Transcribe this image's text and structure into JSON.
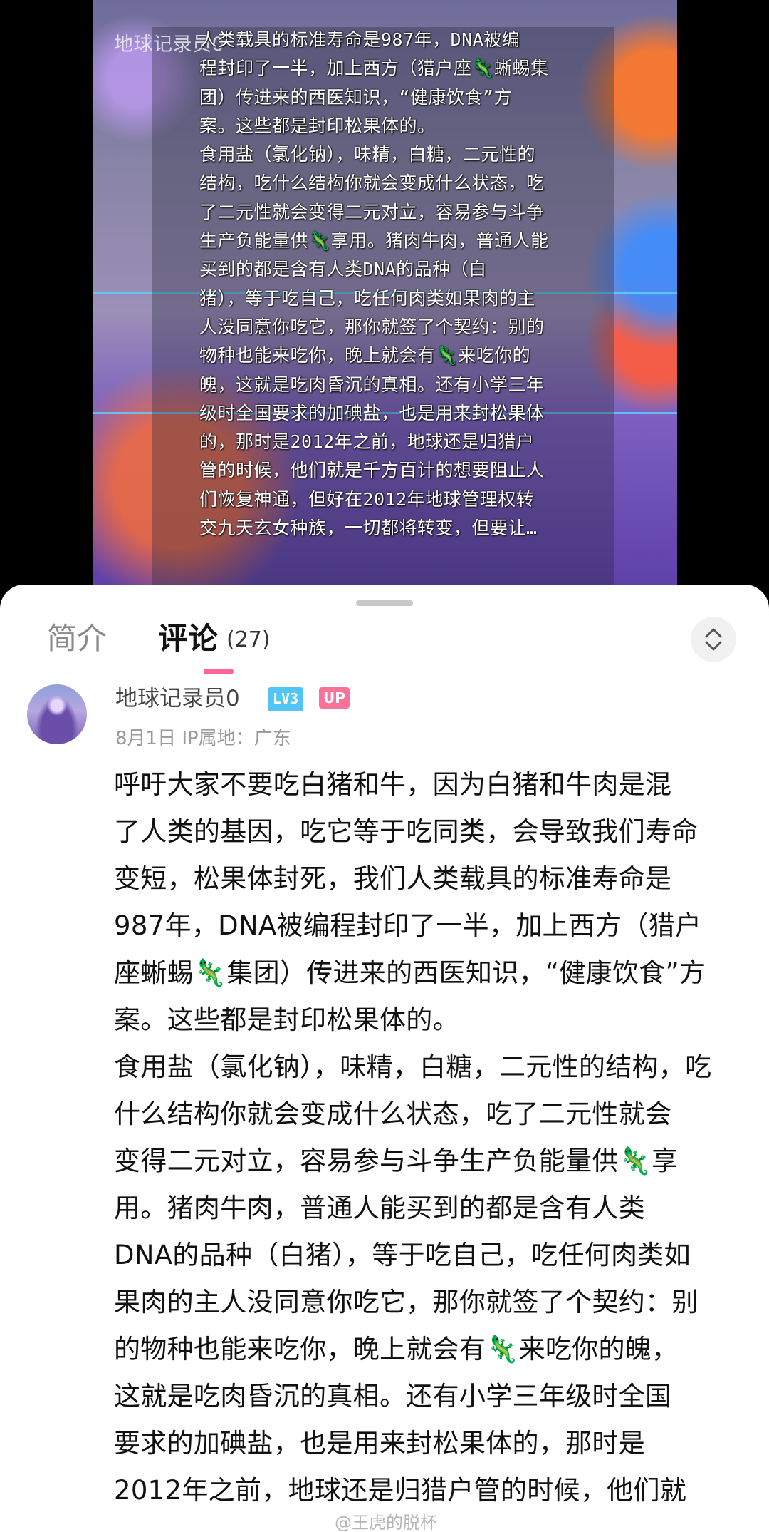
{
  "video": {
    "watermark": "地球记录员0",
    "caption": "人类载具的标准寿命是987年，DNA被编\n程封印了一半，加上西方（猎户座🦎蜥蜴集\n团）传进来的西医知识，“健康饮食”方\n案。这些都是封印松果体的。\n食用盐（氯化钠），味精，白糖，二元性的\n结构，吃什么结构你就会变成什么状态，吃\n了二元性就会变得二元对立，容易参与斗争\n生产负能量供🦎享用。猪肉牛肉，普通人能\n买到的都是含有人类DNA的品种（白\n猪），等于吃自己，吃任何肉类如果肉的主\n人没同意你吃它，那你就签了个契约：别的\n物种也能来吃你，晚上就会有🦎来吃你的\n魄，这就是吃肉昏沉的真相。还有小学三年\n级时全国要求的加碘盐，也是用来封松果体\n的，那时是2012年之前，地球还是归猎户\n管的时候，他们就是千方百计的想要阻止人\n们恢复神通，但好在2012年地球管理权转\n交九天玄女种族，一切都将转变，但要让…"
  },
  "tabs": {
    "intro": "简介",
    "comments": "评论",
    "comments_count": "(27)"
  },
  "comment": {
    "username": "地球记录员0",
    "level_badge": "LV3",
    "up_badge": "UP",
    "meta": "8月1日  IP属地：广东",
    "body": "呼吁大家不要吃白猪和牛，因为白猪和牛肉是混\n了人类的基因，吃它等于吃同类，会导致我们寿命\n变短，松果体封死，我们人类载具的标准寿命是\n987年，DNA被编程封印了一半，加上西方（猎户\n座蜥蜴🦎集团）传进来的西医知识，“健康饮食”方\n案。这些都是封印松果体的。\n食用盐（氯化钠），味精，白糖，二元性的结构，吃\n什么结构你就会变成什么状态，吃了二元性就会\n变得二元对立，容易参与斗争生产负能量供🦎享\n用。猪肉牛肉，普通人能买到的都是含有人类\nDNA的品种（白猪），等于吃自己，吃任何肉类如\n果肉的主人没同意你吃它，那你就签了个契约：别\n的物种也能来吃你，晚上就会有🦎来吃你的魄，\n这就是吃肉昏沉的真相。还有小学三年级时全国\n要求的加碘盐，也是用来封松果体的，那时是\n2012年之前，地球还是归猎户管的时候，他们就"
  },
  "footer": {
    "watermark": "@王虎的脱杯"
  },
  "colors": {
    "accent_pink": "#fb7299",
    "level_blue": "#53c5f5"
  }
}
